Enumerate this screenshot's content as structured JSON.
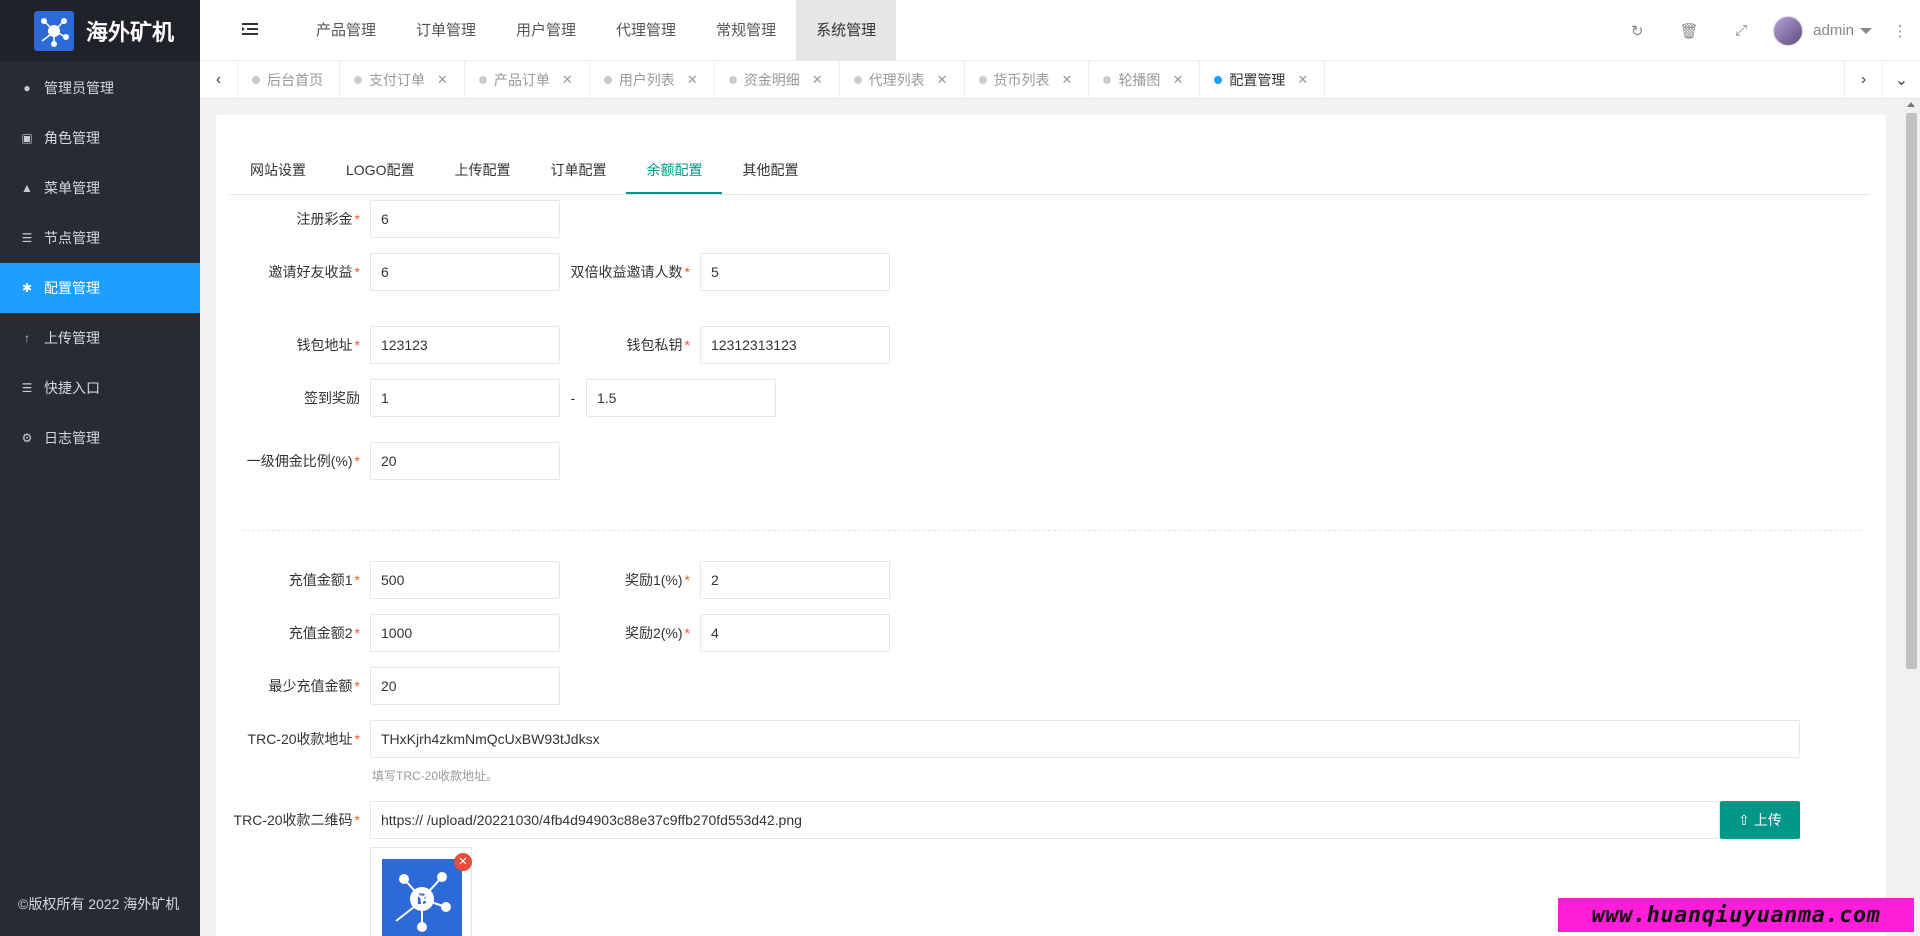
{
  "app": {
    "logo_text": "海外矿机",
    "copyright": "©版权所有 2022 海外矿机"
  },
  "sidebar": {
    "items": [
      {
        "label": "管理员管理",
        "icon": "user-icon",
        "active": false
      },
      {
        "label": "角色管理",
        "icon": "role-icon",
        "active": false
      },
      {
        "label": "菜单管理",
        "icon": "tree-icon",
        "active": false
      },
      {
        "label": "节点管理",
        "icon": "list-icon",
        "active": false
      },
      {
        "label": "配置管理",
        "icon": "gear-icon",
        "active": true
      },
      {
        "label": "上传管理",
        "icon": "arrow-up-icon",
        "active": false
      },
      {
        "label": "快捷入口",
        "icon": "list-icon",
        "active": false
      },
      {
        "label": "日志管理",
        "icon": "log-icon",
        "active": false
      }
    ]
  },
  "header": {
    "topnav": [
      "产品管理",
      "订单管理",
      "用户管理",
      "代理管理",
      "常规管理",
      "系统管理"
    ],
    "active_topnav": "系统管理",
    "user": "admin"
  },
  "tabs": [
    {
      "label": "后台首页",
      "closable": false,
      "active": false
    },
    {
      "label": "支付订单",
      "closable": true,
      "active": false
    },
    {
      "label": "产品订单",
      "closable": true,
      "active": false
    },
    {
      "label": "用户列表",
      "closable": true,
      "active": false
    },
    {
      "label": "资金明细",
      "closable": true,
      "active": false
    },
    {
      "label": "代理列表",
      "closable": true,
      "active": false
    },
    {
      "label": "货币列表",
      "closable": true,
      "active": false
    },
    {
      "label": "轮播图",
      "closable": true,
      "active": false
    },
    {
      "label": "配置管理",
      "closable": true,
      "active": true
    }
  ],
  "subtabs": [
    "网站设置",
    "LOGO配置",
    "上传配置",
    "订单配置",
    "余额配置",
    "其他配置"
  ],
  "active_subtab": "余额配置",
  "form": {
    "register_bonus": {
      "label": "注册彩金",
      "value": "6"
    },
    "invite_income": {
      "label": "邀请好友收益",
      "value": "6"
    },
    "double_invite_count": {
      "label": "双倍收益邀请人数",
      "value": "5"
    },
    "wallet_address": {
      "label": "钱包地址",
      "value": "123123"
    },
    "wallet_key": {
      "label": "钱包私钥",
      "value": "12312313123"
    },
    "signin_reward": {
      "label": "签到奖励",
      "min": "1",
      "max": "1.5",
      "sep": "-"
    },
    "commission_rate": {
      "label": "一级佣金比例(%)",
      "value": "20"
    },
    "recharge_amount_1": {
      "label": "充值金额1",
      "value": "500"
    },
    "reward_1": {
      "label": "奖励1(%)",
      "value": "2"
    },
    "recharge_amount_2": {
      "label": "充值金额2",
      "value": "1000"
    },
    "reward_2": {
      "label": "奖励2(%)",
      "value": "4"
    },
    "min_recharge": {
      "label": "最少充值金额",
      "value": "20"
    },
    "trc20_address": {
      "label": "TRC-20收款地址",
      "value": "THxKjrh4zkmNmQcUxBW93tJdksx",
      "help": "填写TRC-20收款地址。"
    },
    "trc20_qr": {
      "label": "TRC-20收款二维码",
      "value": "https://                         /upload/20221030/4fb4d94903c88e37c9ffb270fd553d42.png",
      "upload_label": "上传"
    }
  },
  "watermark": "www.huanqiuyuanma.com",
  "colors": {
    "sidebar": "#282b33",
    "accent_blue": "#1e9fff",
    "accent_green": "#009688",
    "required": "#ff5722"
  }
}
